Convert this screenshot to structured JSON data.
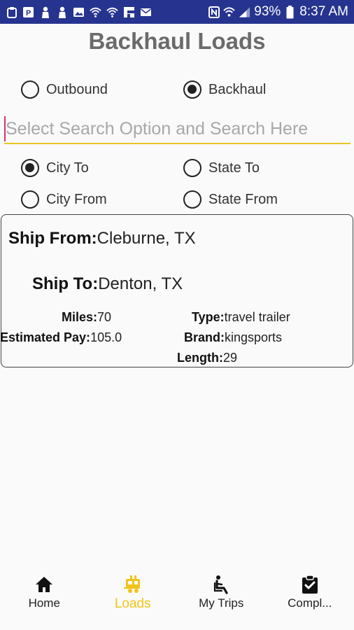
{
  "status_bar": {
    "battery": "93%",
    "time": "8:37 AM",
    "icons_left": [
      "clipboard-icon",
      "parking-icon",
      "person-icon",
      "person-icon",
      "image-icon",
      "wifi-icon",
      "wifi-icon",
      "flipboard-icon",
      "mail-icon"
    ],
    "icons_right": [
      "nfc-icon",
      "wifi-icon",
      "signal-icon",
      "battery-icon"
    ]
  },
  "page": {
    "title": "Backhaul Loads"
  },
  "direction": {
    "outbound_label": "Outbound",
    "backhaul_label": "Backhaul",
    "selected": "Backhaul"
  },
  "search": {
    "placeholder": "Select Search Option and Search Here",
    "value": ""
  },
  "search_options": {
    "city_to": "City To",
    "state_to": "State To",
    "city_from": "City From",
    "state_from": "State From",
    "selected": "City To"
  },
  "load": {
    "ship_from_label": "Ship From:",
    "ship_from": "Cleburne, TX",
    "ship_to_label": "Ship To:",
    "ship_to": "Denton, TX",
    "miles_label": "Miles:",
    "miles": "70",
    "pay_label": "Estimated Pay:",
    "pay": "105.0",
    "type_label": "Type:",
    "type": "travel trailer",
    "brand_label": "Brand:",
    "brand": "kingsports",
    "length_label": "Length:",
    "length": "29"
  },
  "nav": {
    "home": "Home",
    "loads": "Loads",
    "trips": "My Trips",
    "completed": "Compl...",
    "active": "Loads",
    "active_color": "#f0c419"
  },
  "colors": {
    "status_bar": "#26348f",
    "accent": "#e6c728",
    "cursor": "#d6336c"
  }
}
